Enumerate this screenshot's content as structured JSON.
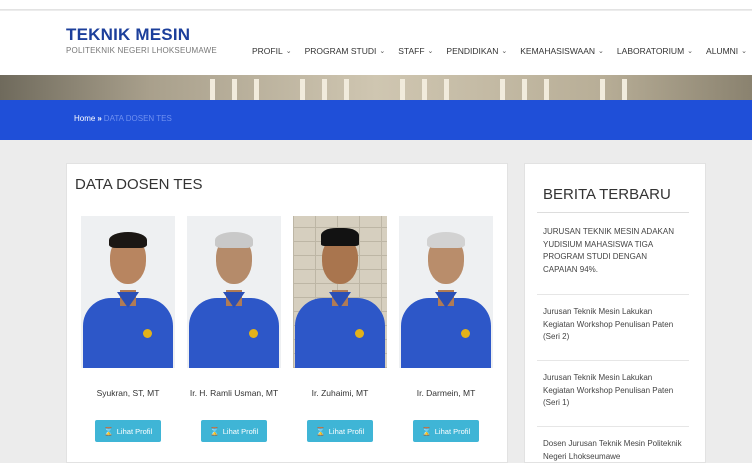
{
  "site": {
    "title": "TEKNIK MESIN",
    "subtitle": "POLITEKNIK NEGERI LHOKSEUMAWE"
  },
  "nav": [
    {
      "label": "PROFIL"
    },
    {
      "label": "PROGRAM STUDI"
    },
    {
      "label": "STAFF"
    },
    {
      "label": "PENDIDIKAN"
    },
    {
      "label": "KEMAHASISWAAN"
    },
    {
      "label": "LABORATORIUM"
    },
    {
      "label": "ALUMNI"
    }
  ],
  "breadcrumb": {
    "home": "Home",
    "separator": "»",
    "current": "DATA DOSEN TES"
  },
  "main": {
    "title": "DATA DOSEN TES",
    "button_label": "Lihat Profil",
    "lecturers": [
      {
        "name": "Syukran, ST, MT"
      },
      {
        "name": "Ir. H. Ramli Usman, MT"
      },
      {
        "name": "Ir. Zuhaimi, MT"
      },
      {
        "name": "Ir. Darmein, MT"
      }
    ]
  },
  "sidebar": {
    "title": "BERITA TERBARU",
    "news": [
      {
        "title": "JURUSAN TEKNIK MESIN ADAKAN YUDISIUM MAHASISWA TIGA PROGRAM STUDI DENGAN CAPAIAN 94%."
      },
      {
        "title": "Jurusan Teknik Mesin Lakukan Kegiatan Workshop Penulisan Paten (Seri 2)"
      },
      {
        "title": "Jurusan Teknik Mesin Lakukan Kegiatan Workshop Penulisan Paten (Seri 1)"
      },
      {
        "title": "Dosen Jurusan Teknik Mesin Politeknik Negeri Lhokseumawe"
      }
    ]
  },
  "colors": {
    "brand": "#1c3f9b",
    "bar": "#1f4fd8",
    "button": "#3fb5d6"
  }
}
